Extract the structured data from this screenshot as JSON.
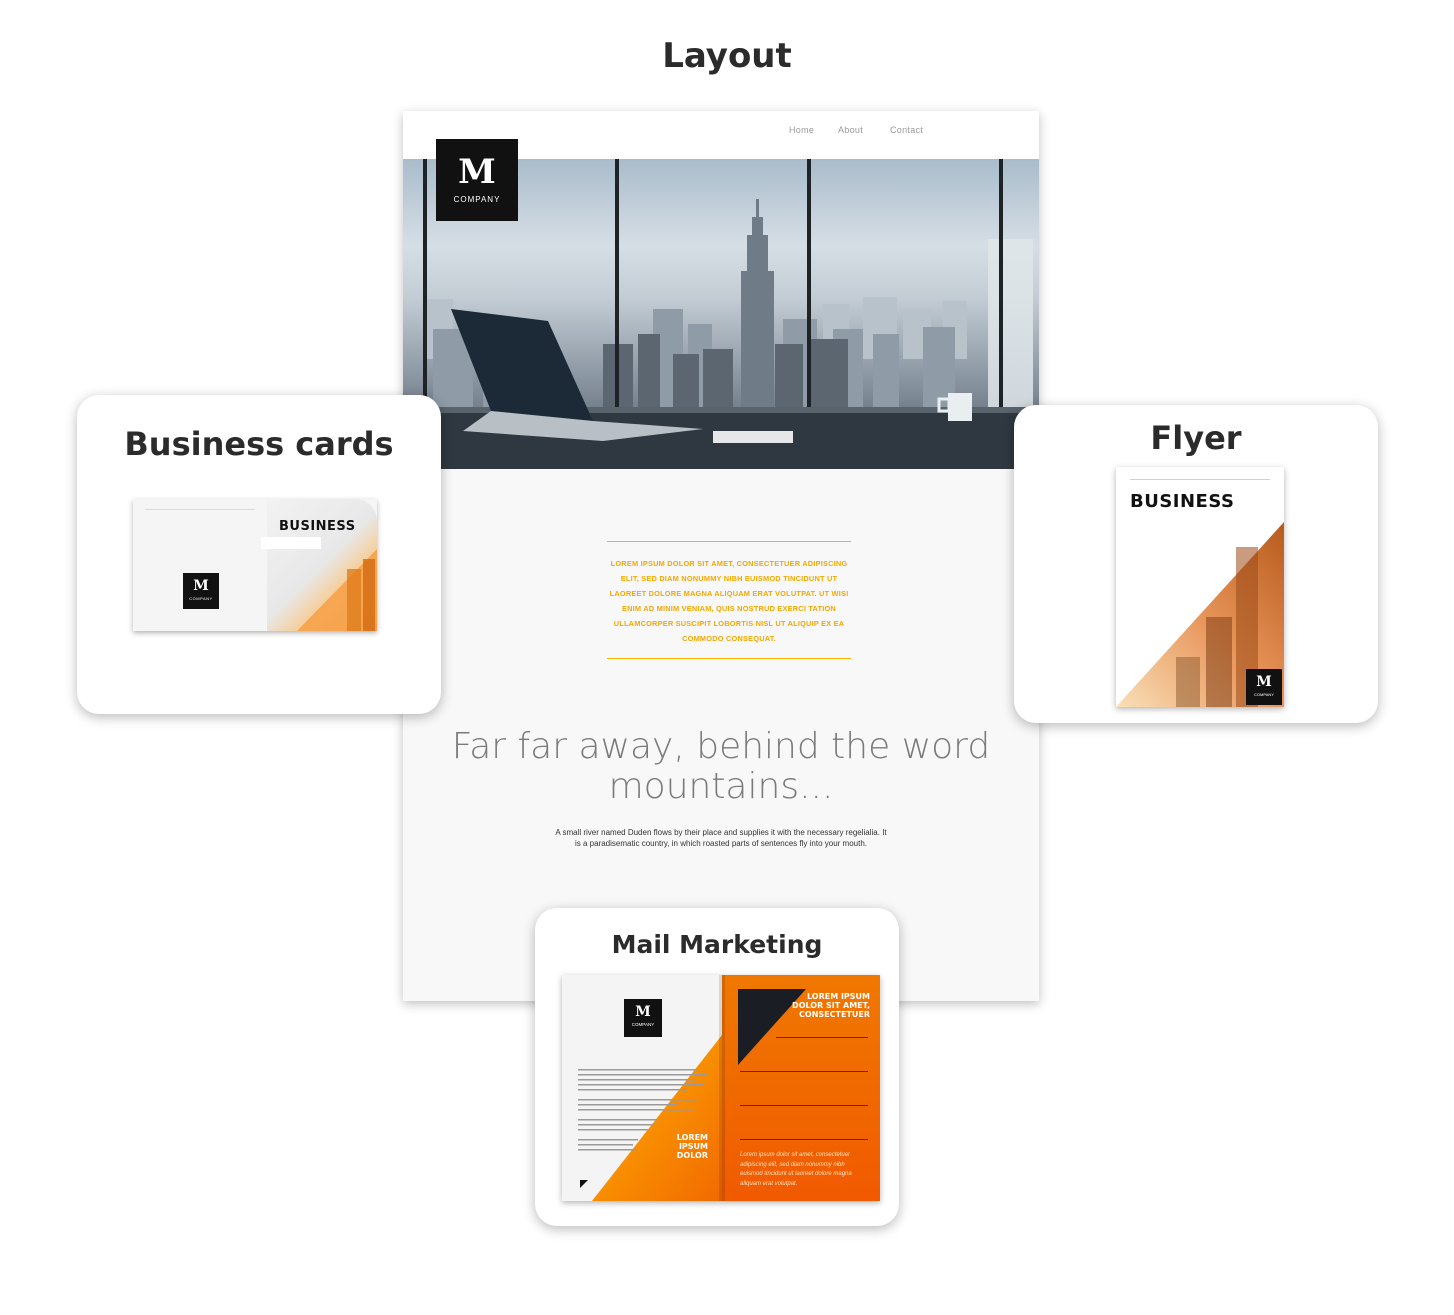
{
  "header": {
    "title": "Layout"
  },
  "website": {
    "logo": {
      "letter": "M",
      "company": "COMPANY"
    },
    "nav": [
      {
        "label": "Home"
      },
      {
        "label": "About"
      },
      {
        "label": "Contact"
      }
    ],
    "intro": "LOREM IPSUM DOLOR SIT AMET, CONSECTETUER ADIPISCING ELIT, SED DIAM NONUMMY NIBH EUISMOD TINCIDUNT UT LAOREET DOLORE MAGNA ALIQUAM ERAT VOLUTPAT.  UT WISI ENIM AD MINIM VENIAM, QUIS NOSTRUD EXERCI TATION ULLAMCORPER SUSCIPIT LOBORTIS NISL UT ALIQUIP EX EA COMMODO CONSEQUAT.",
    "heading": "Far far away, behind the word mountains...",
    "paragraph": "A small river named Duden flows by their place and supplies it with the necessary regelialia. It is a paradisematic country, in which roasted parts of sentences fly into your mouth."
  },
  "business_cards": {
    "title": "Business cards",
    "card_heading": "BUSINESS",
    "logo": {
      "letter": "M",
      "company": "COMPANY"
    }
  },
  "flyer": {
    "title": "Flyer",
    "heading": "BUSINESS",
    "logo": {
      "letter": "M",
      "company": "COMPANY"
    }
  },
  "mail_marketing": {
    "title": "Mail Marketing",
    "logo": {
      "letter": "M",
      "company": "COMPANY"
    },
    "right_heading": "LOREM IPSUM DOLOR SIT AMET, CONSECTETUER",
    "left_heading": "LOREM IPSUM DOLOR",
    "italic_text": "Lorem ipsum dolor sit amet, consectetuer adipiscing elit, sed diam nonummy nibh euismod tincidunt ut laoreet dolore magna aliquam erat volutpat."
  },
  "colors": {
    "accent": "#f4a800",
    "orange": "#f47a00",
    "dark": "#111111",
    "text": "#2b2b2b"
  }
}
